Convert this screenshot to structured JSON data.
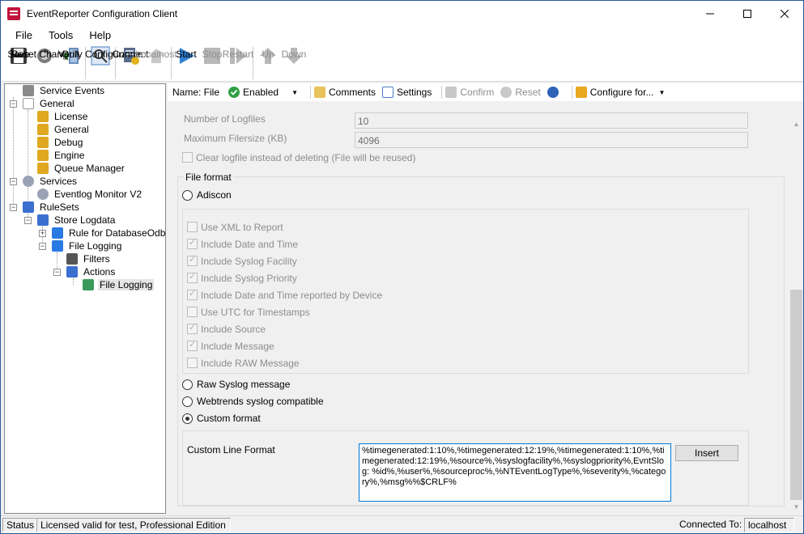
{
  "window": {
    "title": "EventReporter Configuration Client"
  },
  "menubar": {
    "items": [
      "File",
      "Tools",
      "Help"
    ]
  },
  "toolbar": {
    "save": "Save",
    "reset_changes": "Reset Changes",
    "quit": "Quit",
    "verify": "Verify Configuration",
    "connect": "Connect",
    "localhost": "Localhost",
    "start": "Start",
    "stop": "Stop",
    "restart": "Restart",
    "up": "Up",
    "down": "Down"
  },
  "tree": {
    "service_events": "Service Events",
    "general": "General",
    "license": "License",
    "general_child": "General",
    "debug": "Debug",
    "engine": "Engine",
    "queue_manager": "Queue Manager",
    "services": "Services",
    "eventlog_monitor": "Eventlog Monitor V2",
    "rulesets": "RuleSets",
    "store_logdata": "Store Logdata",
    "rule_db": "Rule for DatabaseOdbc",
    "file_logging": "File Logging",
    "filters": "Filters",
    "actions": "Actions",
    "file_logging_action": "File Logging"
  },
  "subtoolbar": {
    "name_label": "Name: File",
    "enabled": "Enabled",
    "comments": "Comments",
    "settings": "Settings",
    "confirm": "Confirm",
    "reset": "Reset",
    "configure_for": "Configure for..."
  },
  "form": {
    "num_logfiles_label": "Number of Logfiles",
    "num_logfiles_value": "10",
    "max_filesize_label": "Maximum Filersize (KB)",
    "max_filesize_value": "4096",
    "clear_logfile_label": "Clear logfile instead of deleting (File will be reused)",
    "file_format_group": "File format",
    "adiscon_label": "Adiscon",
    "options": [
      {
        "label": "Use XML to Report",
        "checked": false
      },
      {
        "label": "Include Date and Time",
        "checked": true
      },
      {
        "label": "Include Syslog Facility",
        "checked": true
      },
      {
        "label": "Include Syslog Priority",
        "checked": true
      },
      {
        "label": "Include Date and Time reported by Device",
        "checked": true
      },
      {
        "label": "Use UTC for Timestamps",
        "checked": false
      },
      {
        "label": "Include Source",
        "checked": true
      },
      {
        "label": "Include Message",
        "checked": true
      },
      {
        "label": "Include RAW Message",
        "checked": false
      }
    ],
    "raw_syslog_label": "Raw Syslog message",
    "webtrends_label": "Webtrends syslog compatible",
    "custom_format_label": "Custom format",
    "custom_line_format_label": "Custom Line Format",
    "custom_line_format_value": "%timegenerated:1:10%,%timegenerated:12:19%,%timegenerated:1:10%,%timegenerated:12:19%,%source%,%syslogfacility%,%syslogpriority%,EvntSlog: %id%,%user%,%sourceproc%,%NTEventLogType%,%severity%,%category%,%msg%%$CRLF%",
    "insert_button": "Insert"
  },
  "statusbar": {
    "status": "Status",
    "license": "Licensed valid for test, Professional Edition",
    "connected_to": "Connected To:",
    "host": "localhost"
  }
}
